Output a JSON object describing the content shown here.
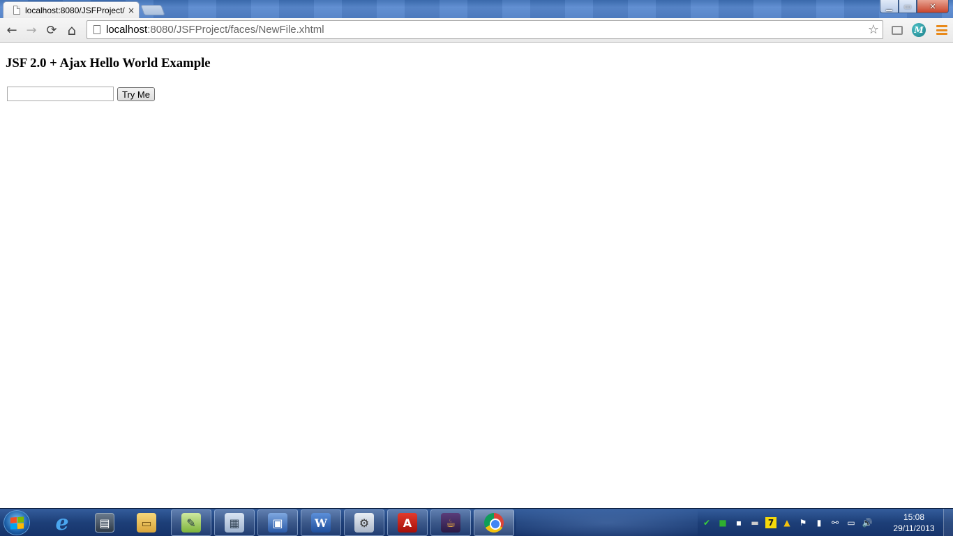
{
  "browser": {
    "tab": {
      "title": "localhost:8080/JSFProject/",
      "close_glyph": "×"
    },
    "window_controls": {
      "minimize": "▁",
      "maximize": "▭",
      "close": "✕"
    },
    "toolbar": {
      "back_icon": "back-arrow-icon",
      "forward_icon": "forward-arrow-icon",
      "reload_icon": "reload-icon",
      "home_icon": "home-icon",
      "back": "←",
      "forward": "→",
      "reload": "⟳",
      "home": "⌂",
      "star": "☆",
      "extension_m": "M"
    },
    "address_bar": {
      "host": "localhost",
      "rest": ":8080/JSFProject/faces/NewFile.xhtml"
    }
  },
  "page": {
    "heading": "JSF 2.0 + Ajax Hello World Example",
    "name_input": {
      "value": "",
      "placeholder": ""
    },
    "try_button": "Try Me"
  },
  "taskbar": {
    "apps": [
      {
        "name": "internet-explorer",
        "glyph": "e"
      },
      {
        "name": "task-manager",
        "glyph": "▤"
      },
      {
        "name": "windows-explorer",
        "glyph": "▭"
      },
      {
        "name": "notepad-plus-plus",
        "glyph": "✎"
      },
      {
        "name": "calculator",
        "glyph": "▦"
      },
      {
        "name": "remote-desktop",
        "glyph": "▣"
      },
      {
        "name": "microsoft-word",
        "glyph": "W"
      },
      {
        "name": "eclipse-tomcat",
        "glyph": "⚙"
      },
      {
        "name": "adobe-reader",
        "glyph": "A"
      },
      {
        "name": "java-ee-ide",
        "glyph": "☕"
      },
      {
        "name": "google-chrome",
        "glyph": ""
      }
    ],
    "tray": [
      "✔",
      "■",
      "▪",
      "▬",
      "7",
      "▲",
      "⚑",
      "▮",
      "⚯",
      "▭",
      "🔊"
    ],
    "clock": {
      "time": "15:08",
      "date": "29/11/2013"
    }
  },
  "colors": {
    "taskbar": "#1d3f78",
    "titlebar": "#4f7fc6",
    "accent_orange": "#e8891a"
  }
}
